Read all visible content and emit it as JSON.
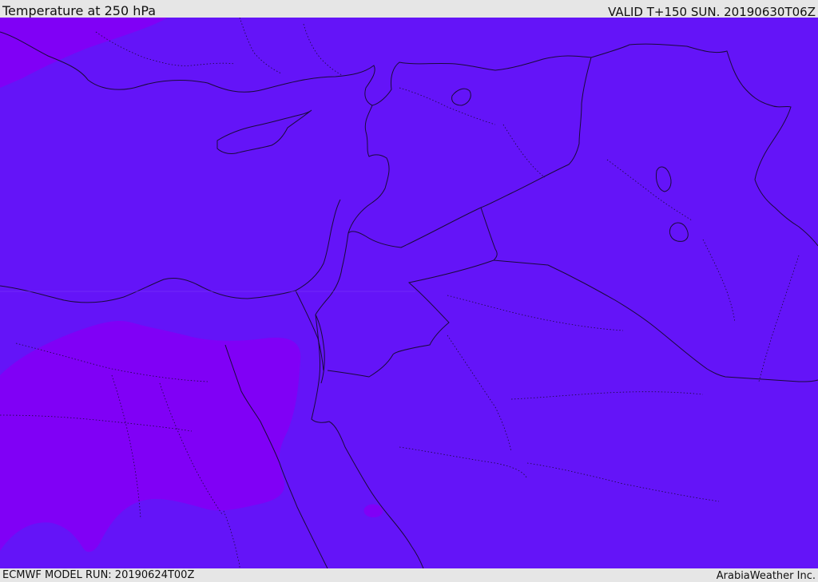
{
  "header": {
    "title": "Temperature at 250 hPa",
    "valid": "VALID T+150 SUN. 20190630T06Z"
  },
  "footer": {
    "model_run": "ECMWF MODEL RUN: 20190624T00Z",
    "credit": "ArabiaWeather Inc."
  },
  "colors": {
    "base_fill": "#6414f8",
    "warm_fill": "#8000f6",
    "coast_line": "#1a0a3a",
    "border_line": "#1a0a3a",
    "bar_background": "#e6e6e6"
  }
}
